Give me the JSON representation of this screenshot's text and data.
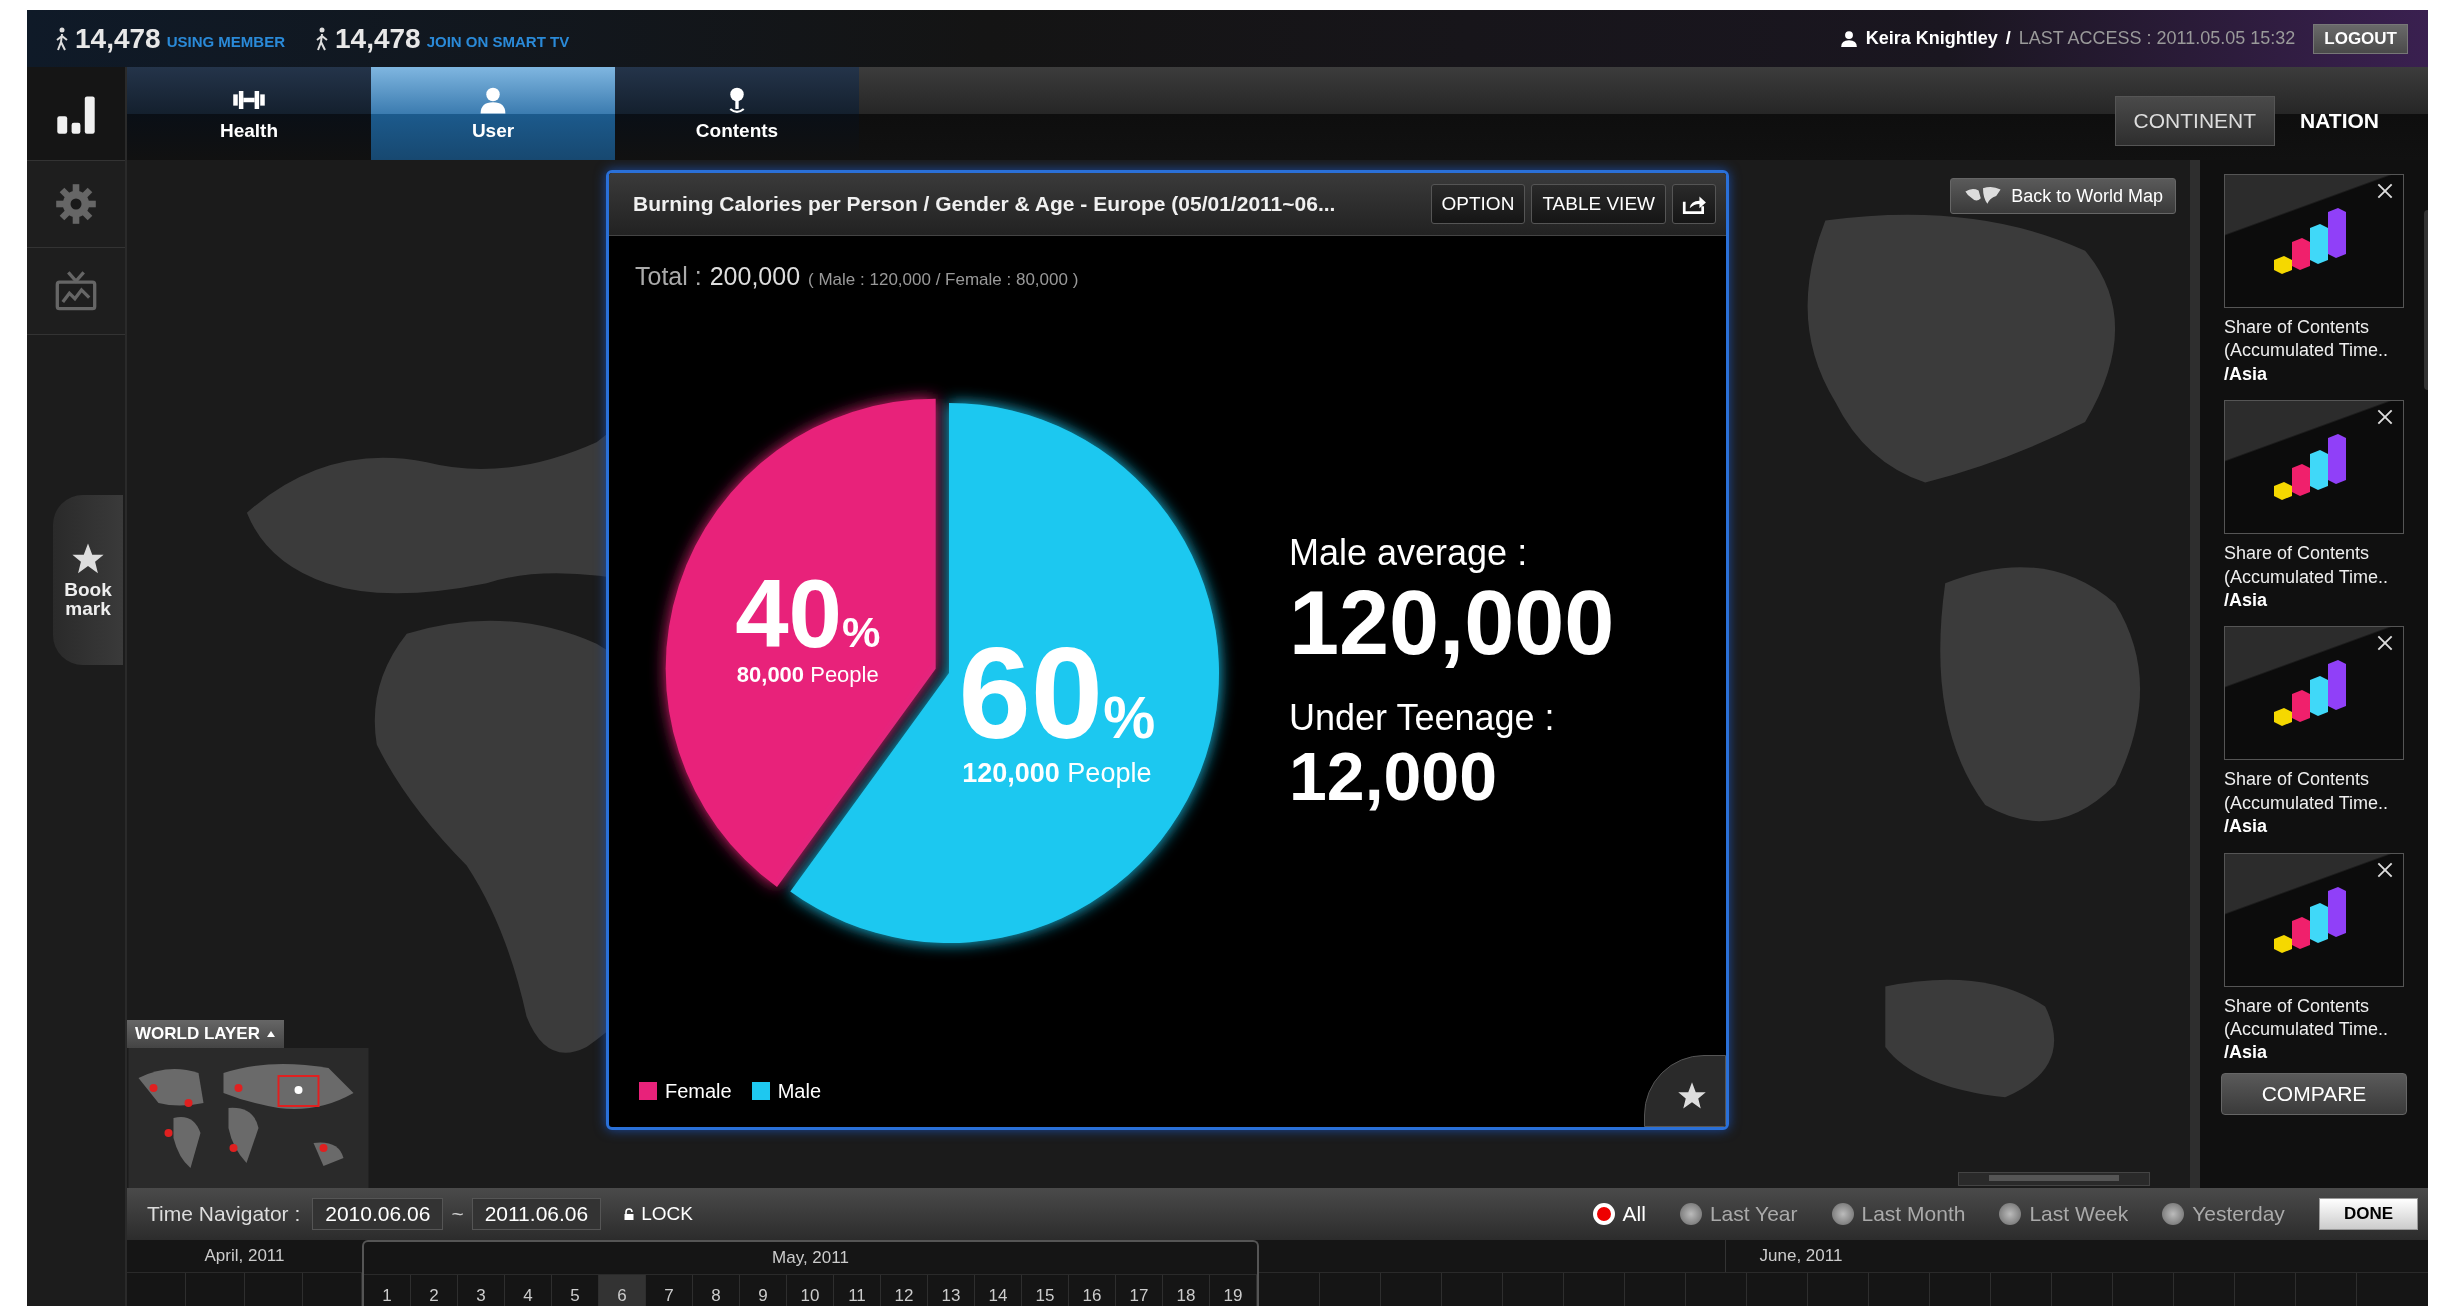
{
  "top_bar": {
    "stats": [
      {
        "count": "14,478",
        "label": "USING MEMBER"
      },
      {
        "count": "14,478",
        "label": "JOIN ON SMART TV"
      }
    ],
    "user": "Keira Knightley",
    "separator": "/",
    "last_access": "LAST ACCESS : 2011.05.05 15:32",
    "logout": "LOGOUT"
  },
  "sidebar": {
    "items": [
      {
        "kind": "chart",
        "selected": true
      },
      {
        "kind": "gear",
        "selected": false
      },
      {
        "kind": "tv",
        "selected": false
      }
    ],
    "bookmark": "Book mark"
  },
  "tabs": [
    {
      "label": "Health",
      "kind": "dumbbell",
      "selected": false
    },
    {
      "label": "User",
      "kind": "person",
      "selected": true
    },
    {
      "label": "Contents",
      "kind": "joystick",
      "selected": false
    }
  ],
  "scope_tabs": [
    {
      "label": "CONTINENT",
      "selected": true
    },
    {
      "label": "NATION",
      "selected": false
    }
  ],
  "back_button": "Back to World Map",
  "dialog": {
    "title": "Burning Calories per Person / Gender & Age - Europe (05/01/2011~06...",
    "buttons": [
      "OPTION",
      "TABLE VIEW"
    ],
    "total_label": "Total :",
    "total_value": "200,000",
    "total_detail": "( Male : 120,000 / Female : 80,000 )",
    "chart_data": {
      "type": "pie",
      "categories": [
        "Female",
        "Male"
      ],
      "values": [
        40,
        60
      ]
    },
    "slice_labels": [
      {
        "percent": "40",
        "unit": "%",
        "count": "80,000",
        "suffix": "People"
      },
      {
        "percent": "60",
        "unit": "%",
        "count": "120,000",
        "suffix": "People"
      }
    ],
    "stats": [
      {
        "label": "Male average :",
        "value": "120,000"
      },
      {
        "label": "Under Teenage :",
        "value": "12,000"
      }
    ],
    "legend": [
      {
        "color": "#e8227a"
      },
      {
        "color": "#1ec8f0"
      }
    ]
  },
  "world_layer": {
    "label": "WORLD LAYER"
  },
  "panel": {
    "items": [
      {
        "title": "Share of Contents (Accumulated Time..",
        "region": "/Asia"
      },
      {
        "title": "Share of Contents (Accumulated Time..",
        "region": "/Asia"
      },
      {
        "title": "Share of Contents (Accumulated Time..",
        "region": "/Asia"
      },
      {
        "title": "Share of Contents (Accumulated Time..",
        "region": "/Asia"
      }
    ],
    "compare": "COMPARE"
  },
  "time_navigator": {
    "label": "Time Navigator :",
    "from": "2010.06.06",
    "separator": "~",
    "to": "2011.06.06",
    "lock": "LOCK",
    "ranges": [
      {
        "label": "All",
        "selected": true
      },
      {
        "label": "Last Year",
        "selected": false
      },
      {
        "label": "Last Month",
        "selected": false
      },
      {
        "label": "Last Week",
        "selected": false
      },
      {
        "label": "Yesterday",
        "selected": false
      }
    ],
    "done": "DONE"
  },
  "calendar": {
    "months": [
      {
        "label": "April, 2011"
      },
      {
        "label": "May, 2011"
      },
      {
        "label": "June, 2011"
      }
    ],
    "days": [
      {
        "label": "1",
        "selected": false
      },
      {
        "label": "2",
        "selected": false
      },
      {
        "label": "3",
        "selected": false
      },
      {
        "label": "4",
        "selected": false
      },
      {
        "label": "5",
        "selected": false
      },
      {
        "label": "6",
        "selected": true
      },
      {
        "label": "7",
        "selected": false
      },
      {
        "label": "8",
        "selected": false
      },
      {
        "label": "9",
        "selected": false
      },
      {
        "label": "10",
        "selected": false
      },
      {
        "label": "11",
        "selected": false
      },
      {
        "label": "12",
        "selected": false
      },
      {
        "label": "13",
        "selected": false
      },
      {
        "label": "14",
        "selected": false
      },
      {
        "label": "15",
        "selected": false
      },
      {
        "label": "16",
        "selected": false
      },
      {
        "label": "17",
        "selected": false
      },
      {
        "label": "18",
        "selected": false
      },
      {
        "label": "19",
        "selected": false
      }
    ]
  }
}
